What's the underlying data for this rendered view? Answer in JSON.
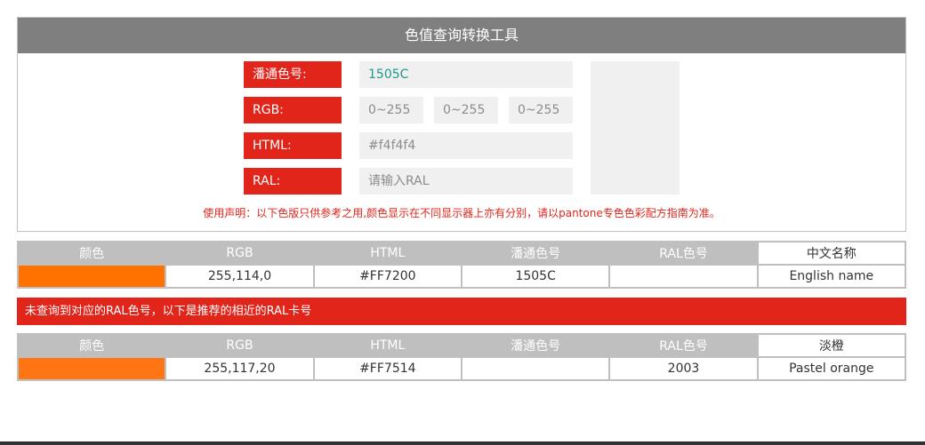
{
  "tool": {
    "title": "色值查询转换工具",
    "pantone_label": "潘通色号:",
    "pantone_value": "1505C",
    "rgb_label": "RGB:",
    "rgb_placeholder_r": "0~255",
    "rgb_placeholder_g": "0~255",
    "rgb_placeholder_b": "0~255",
    "html_label": "HTML:",
    "html_placeholder": "#f4f4f4",
    "ral_label": "RAL:",
    "ral_placeholder": "请输入RAL",
    "swatch_color": "#f0f0f0",
    "notice": "使用声明：以下色版只供参考之用,颜色显示在不同显示器上亦有分别，请以pantone专色色彩配方指南为准。"
  },
  "result": {
    "headers": [
      "颜色",
      "RGB",
      "HTML",
      "潘通色号",
      "RAL色号",
      "中文名称"
    ],
    "row": {
      "color": "#FF7200",
      "rgb": "255,114,0",
      "html": "#FF7200",
      "pantone": "1505C",
      "ral": "",
      "name": "English name"
    }
  },
  "alert": "未查询到对应的RAL色号，以下是推荐的相近的RAL卡号",
  "recommend": {
    "headers": [
      "颜色",
      "RGB",
      "HTML",
      "潘通色号",
      "RAL色号",
      "淡橙"
    ],
    "row": {
      "color": "#FF7514",
      "rgb": "255,117,20",
      "html": "#FF7514",
      "pantone": "",
      "ral": "2003",
      "name": "Pastel orange"
    }
  }
}
